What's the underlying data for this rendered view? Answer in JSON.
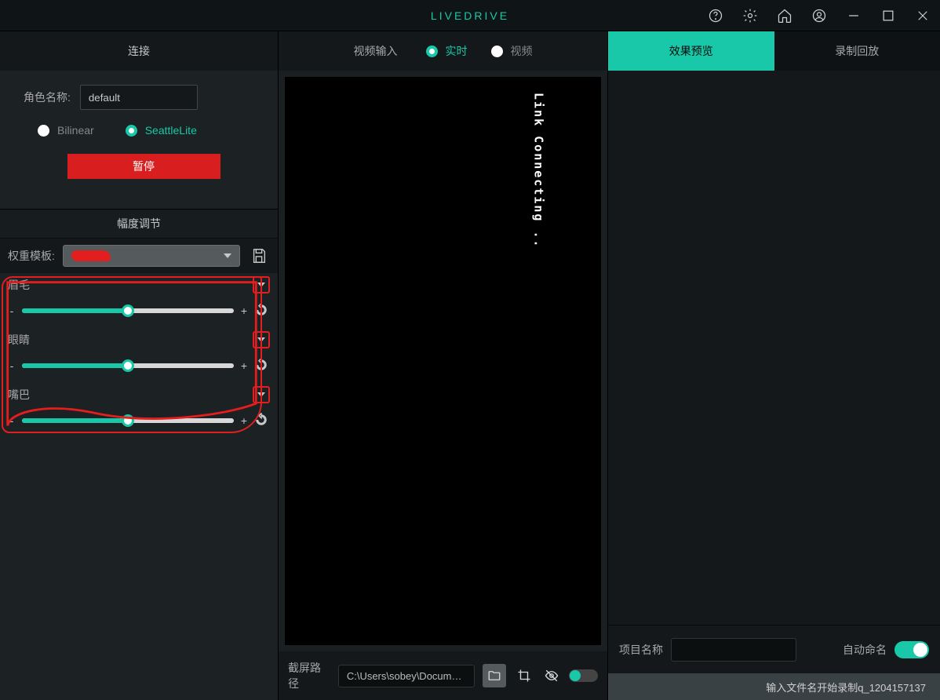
{
  "app": {
    "title": "LIVEDRIVE"
  },
  "sidebar": {
    "header": "连接",
    "role_label": "角色名称:",
    "role_value": "default",
    "radio_bilinear": "Bilinear",
    "radio_seattle": "SeattleLite",
    "pause_label": "暂停",
    "amplitude_title": "幅度调节",
    "template_label": "权重模板:"
  },
  "sliders": [
    {
      "label": "眉毛",
      "percent": 50
    },
    {
      "label": "眼睛",
      "percent": 50
    },
    {
      "label": "嘴巴",
      "percent": 50
    }
  ],
  "center": {
    "input_label": "视频输入",
    "radio_live": "实时",
    "radio_video": "视频",
    "link_status": "Link Connecting ..",
    "path_label": "截屏路径",
    "path_value": "C:\\Users\\sobey\\Document..."
  },
  "right": {
    "tab_preview": "效果预览",
    "tab_playback": "录制回放",
    "project_label": "项目名称",
    "autoname_label": "自动命名",
    "status_text": "输入文件名开始录制q_1204157137"
  }
}
